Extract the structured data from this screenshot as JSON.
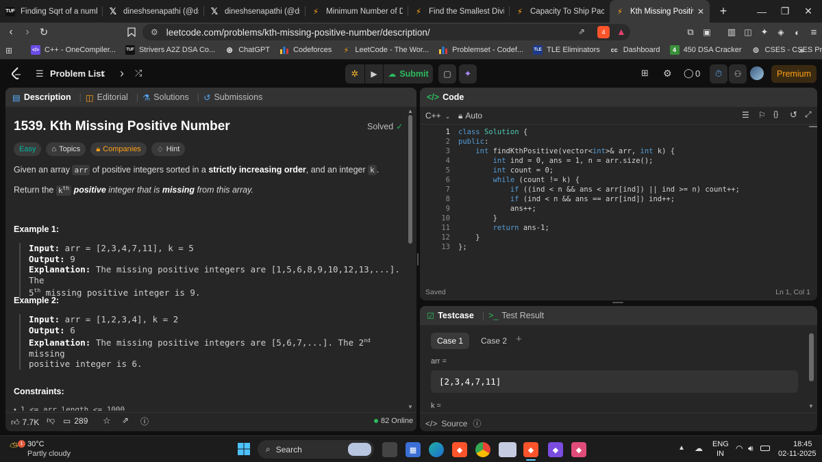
{
  "browser": {
    "tabs": [
      {
        "title": "Finding Sqrt of a number u",
        "favicon": "tuf-icon"
      },
      {
        "title": "dineshsenapathi (@dsenap",
        "favicon": "x-icon"
      },
      {
        "title": "dineshsenapathi (@dsenap",
        "favicon": "x-icon"
      },
      {
        "title": "Minimum Number of Days",
        "favicon": "leetcode-icon"
      },
      {
        "title": "Find the Smallest Divisor G",
        "favicon": "leetcode-icon"
      },
      {
        "title": "Capacity To Ship Packages",
        "favicon": "leetcode-icon"
      },
      {
        "title": "Kth Missing Positive N",
        "favicon": "leetcode-icon",
        "active": true
      }
    ],
    "url": "leetcode.com/problems/kth-missing-positive-number/description/",
    "shield_count": "4",
    "bookmarks": [
      {
        "label": "C++ - OneCompiler..."
      },
      {
        "label": "Strivers A2Z DSA Co..."
      },
      {
        "label": "ChatGPT"
      },
      {
        "label": "Codeforces"
      },
      {
        "label": "LeetCode - The Wor..."
      },
      {
        "label": "Problemset - Codef..."
      },
      {
        "label": "TLE Eliminators"
      },
      {
        "label": "Dashboard"
      },
      {
        "label": "450 DSA Cracker"
      },
      {
        "label": "CSES - CSES Proble..."
      }
    ],
    "bookmark_icon_text": {
      "onecompiler": "</>",
      "striver": "TUF",
      "tle": "TLE",
      "cc": "cc",
      "dsa": "4"
    },
    "more": "»"
  },
  "header": {
    "problem_list": "Problem List",
    "submit": "Submit",
    "streak": "0",
    "premium": "Premium"
  },
  "left": {
    "tabs": {
      "description": "Description",
      "editorial": "Editorial",
      "solutions": "Solutions",
      "submissions": "Submissions"
    },
    "title": "1539. Kth Missing Positive Number",
    "status": "Solved",
    "chips": {
      "easy": "Easy",
      "topics": "Topics",
      "companies": "Companies",
      "hint": "Hint"
    },
    "para1": {
      "a": "Given an array ",
      "code1": "arr",
      "b": " of positive integers sorted in a ",
      "bold": "strictly increasing order",
      "c": ", and an integer ",
      "code2": "k",
      "d": "."
    },
    "para2": {
      "a": "Return the ",
      "code": "k",
      "sup": "th",
      "b": " positive",
      "c": " integer that is ",
      "d": "missing",
      "e": " from this array."
    },
    "example1": {
      "heading": "Example 1:",
      "input_label": "Input:",
      "input": " arr = [2,3,4,7,11], k = 5",
      "output_label": "Output:",
      "output": " 9",
      "expl_label": "Explanation:",
      "expl": " The missing positive integers are [1,5,6,8,9,10,12,13,...]. The",
      "expl2_pre": "5",
      "expl2_sup": "th",
      "expl2": " missing positive integer is 9."
    },
    "example2": {
      "heading": "Example 2:",
      "input_label": "Input:",
      "input": " arr = [1,2,3,4], k = 2",
      "output_label": "Output:",
      "output": " 6",
      "expl_label": "Explanation:",
      "expl_a": " The missing positive integers are [5,6,7,...]. The 2",
      "expl_sup": "nd",
      "expl_b": " missing",
      "expl2": "positive integer is 6."
    },
    "constraints": "Constraints:",
    "constraint_peek": "1 <= arr.length <= 1000",
    "footer": {
      "likes": "7.7K",
      "comments": "289",
      "online": "82 Online"
    }
  },
  "code": {
    "title": "Code",
    "language": "C++",
    "mode": "Auto",
    "lines": [
      "class Solution {",
      "public:",
      "    int findKthPositive(vector<int>& arr, int k) {",
      "        int ind = 0, ans = 1, n = arr.size();",
      "        int count = 0;",
      "        while (count != k) {",
      "            if ((ind < n && ans < arr[ind]) || ind >= n) count++;",
      "            if (ind < n && ans == arr[ind]) ind++;",
      "            ans++;",
      "        }",
      "        return ans-1;",
      "    }",
      "};"
    ],
    "status": "Saved",
    "cursor": "Ln 1, Col 1"
  },
  "testcase": {
    "tab_testcase": "Testcase",
    "tab_result": "Test Result",
    "case1": "Case 1",
    "case2": "Case 2",
    "add": "+",
    "arr_label": "arr =",
    "arr_value": "[2,3,4,7,11]",
    "k_label": "k =",
    "source": "Source"
  },
  "taskbar": {
    "temp": "30°C",
    "weather": "Partly cloudy",
    "weather_badge": "1",
    "search": "Search",
    "lang": "ENG",
    "region": "IN",
    "time": "18:45",
    "date": "02-11-2025"
  },
  "colors": {
    "accent_green": "#2cbb5d",
    "easy": "#00b8a3",
    "premium": "#ffa116",
    "link": "#56a7f5"
  }
}
